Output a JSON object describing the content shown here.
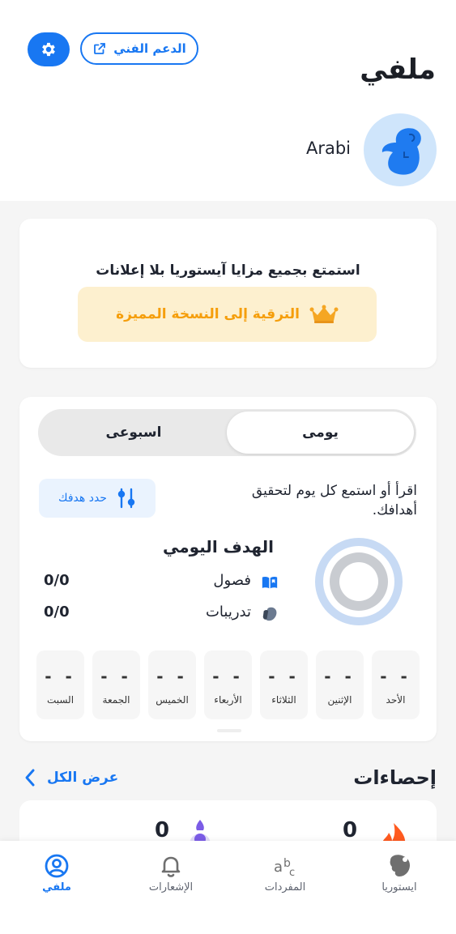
{
  "header": {
    "title": "ملفي",
    "support_label": "الدعم الفني",
    "username": "Arabi"
  },
  "premium": {
    "text": "استمتع بجميع مزايا آيستوريا بلا إعلانات",
    "upgrade_label": "الترقية إلى النسخة المميزة"
  },
  "goal": {
    "tabs": [
      {
        "label": "يومى",
        "active": true
      },
      {
        "label": "اسبوعى",
        "active": false
      }
    ],
    "set_goal_label": "حدد هدفك",
    "description": "اقرأ أو استمع كل يوم لتحقيق أهدافك.",
    "daily_title": "الهدف اليومي",
    "metrics": [
      {
        "label": "فصول",
        "value": "0/0"
      },
      {
        "label": "تدريبات",
        "value": "0/0"
      }
    ],
    "days": [
      {
        "name": "الأحد",
        "value": "- -"
      },
      {
        "name": "الإثنين",
        "value": "- -"
      },
      {
        "name": "الثلاثاء",
        "value": "- -"
      },
      {
        "name": "الأربعاء",
        "value": "- -"
      },
      {
        "name": "الخميس",
        "value": "- -"
      },
      {
        "name": "الجمعة",
        "value": "- -"
      },
      {
        "name": "السبت",
        "value": "- -"
      }
    ]
  },
  "stats": {
    "title": "إحصاءات",
    "view_all": "عرض الكل",
    "values": [
      "0",
      "0"
    ]
  },
  "nav": {
    "items": [
      {
        "label": "ايستوريا",
        "icon": "istoria-logo-icon"
      },
      {
        "label": "المفردات",
        "icon": "vocabulary-icon"
      },
      {
        "label": "الإشعارات",
        "icon": "bell-icon"
      },
      {
        "label": "ملفي",
        "icon": "profile-icon",
        "active": true
      }
    ]
  },
  "colors": {
    "accent": "#1877f2",
    "premium_bg": "#fdf0cf",
    "premium_text": "#f59e0b",
    "avatar_bg": "#cfe5fb"
  }
}
